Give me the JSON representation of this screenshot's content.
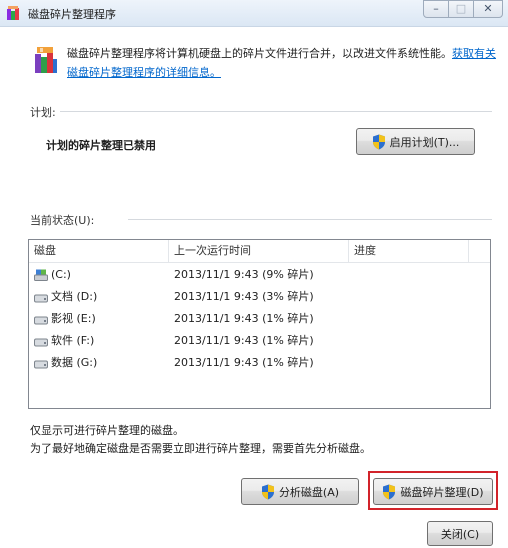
{
  "window": {
    "title": "磁盘碎片整理程序",
    "controls": {
      "minimize": "–",
      "maximize": "□",
      "close": "✕"
    }
  },
  "header": {
    "description": "磁盘碎片整理程序将计算机硬盘上的碎片文件进行合并，以改进文件系统性能。",
    "link": "获取有关磁盘碎片整理程序的详细信息。",
    "icon": "defrag-app-icon"
  },
  "schedule": {
    "label": "计划:",
    "status": "计划的碎片整理已禁用",
    "button": "启用计划(T)..."
  },
  "current_status": {
    "label": "当前状态(U):",
    "columns": [
      "磁盘",
      "上一次运行时间",
      "进度"
    ],
    "disks": [
      {
        "name": "(C:)",
        "last_run": "2013/11/1 9:43 (9% 碎片)",
        "progress": "",
        "icon": "system-drive-icon"
      },
      {
        "name": "文档 (D:)",
        "last_run": "2013/11/1 9:43 (3% 碎片)",
        "progress": "",
        "icon": "hard-drive-icon"
      },
      {
        "name": "影视 (E:)",
        "last_run": "2013/11/1 9:43 (1% 碎片)",
        "progress": "",
        "icon": "hard-drive-icon"
      },
      {
        "name": "软件 (F:)",
        "last_run": "2013/11/1 9:43 (1% 碎片)",
        "progress": "",
        "icon": "hard-drive-icon"
      },
      {
        "name": "数据 (G:)",
        "last_run": "2013/11/1 9:43 (1% 碎片)",
        "progress": "",
        "icon": "hard-drive-icon"
      }
    ]
  },
  "notes": {
    "line1": "仅显示可进行碎片整理的磁盘。",
    "line2": "为了最好地确定磁盘是否需要立即进行碎片整理，需要首先分析磁盘。"
  },
  "actions": {
    "analyze": "分析磁盘(A)",
    "defragment": "磁盘碎片整理(D)",
    "close": "关闭(C)"
  },
  "colors": {
    "link": "#0066cc",
    "highlight_border": "#d2232a",
    "shield_blue": "#2b6fcf",
    "shield_yellow": "#f2c21a"
  }
}
